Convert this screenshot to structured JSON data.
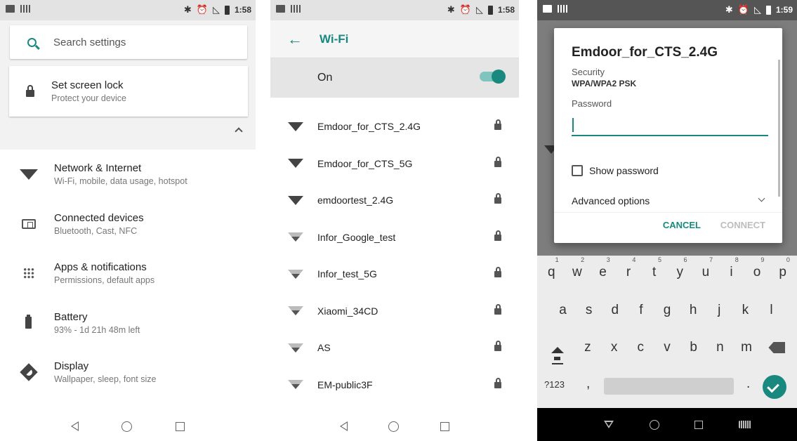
{
  "status1": {
    "time": "1:58"
  },
  "status2": {
    "time": "1:58"
  },
  "status3": {
    "time": "1:59"
  },
  "settings": {
    "search_placeholder": "Search settings",
    "suggestion": {
      "title": "Set screen lock",
      "subtitle": "Protect your device"
    },
    "items": [
      {
        "icon": "wifi-icon",
        "title": "Network & Internet",
        "subtitle": "Wi-Fi, mobile, data usage, hotspot"
      },
      {
        "icon": "devices-icon",
        "title": "Connected devices",
        "subtitle": "Bluetooth, Cast, NFC"
      },
      {
        "icon": "apps-icon",
        "title": "Apps & notifications",
        "subtitle": "Permissions, default apps"
      },
      {
        "icon": "battery-icon",
        "title": "Battery",
        "subtitle": "93% - 1d 21h 48m left"
      },
      {
        "icon": "display-icon",
        "title": "Display",
        "subtitle": "Wallpaper, sleep, font size"
      }
    ]
  },
  "wifi": {
    "title": "Wi-Fi",
    "toggle_label": "On",
    "toggle_on": true,
    "networks": [
      {
        "name": "Emdoor_for_CTS_2.4G",
        "signal": "full"
      },
      {
        "name": "Emdoor_for_CTS_5G",
        "signal": "full"
      },
      {
        "name": "emdoortest_2.4G",
        "signal": "full"
      },
      {
        "name": "Infor_Google_test",
        "signal": "partial"
      },
      {
        "name": "Infor_test_5G",
        "signal": "partial"
      },
      {
        "name": "Xiaomi_34CD",
        "signal": "partial"
      },
      {
        "name": "AS",
        "signal": "partial"
      },
      {
        "name": "EM-public3F",
        "signal": "partial"
      }
    ]
  },
  "dialog": {
    "title": "Emdoor_for_CTS_2.4G",
    "security_label": "Security",
    "security_value": "WPA/WPA2 PSK",
    "password_label": "Password",
    "password_value": "",
    "show_password": "Show password",
    "advanced": "Advanced options",
    "cancel": "CANCEL",
    "connect": "CONNECT"
  },
  "keyboard": {
    "row1": [
      {
        "k": "q",
        "n": "1"
      },
      {
        "k": "w",
        "n": "2"
      },
      {
        "k": "e",
        "n": "3"
      },
      {
        "k": "r",
        "n": "4"
      },
      {
        "k": "t",
        "n": "5"
      },
      {
        "k": "y",
        "n": "6"
      },
      {
        "k": "u",
        "n": "7"
      },
      {
        "k": "i",
        "n": "8"
      },
      {
        "k": "o",
        "n": "9"
      },
      {
        "k": "p",
        "n": "0"
      }
    ],
    "row2": [
      "a",
      "s",
      "d",
      "f",
      "g",
      "h",
      "j",
      "k",
      "l"
    ],
    "row3": [
      "z",
      "x",
      "c",
      "v",
      "b",
      "n",
      "m"
    ],
    "sym": "?123",
    "comma": ",",
    "period": "."
  },
  "colors": {
    "accent": "#19897f"
  }
}
